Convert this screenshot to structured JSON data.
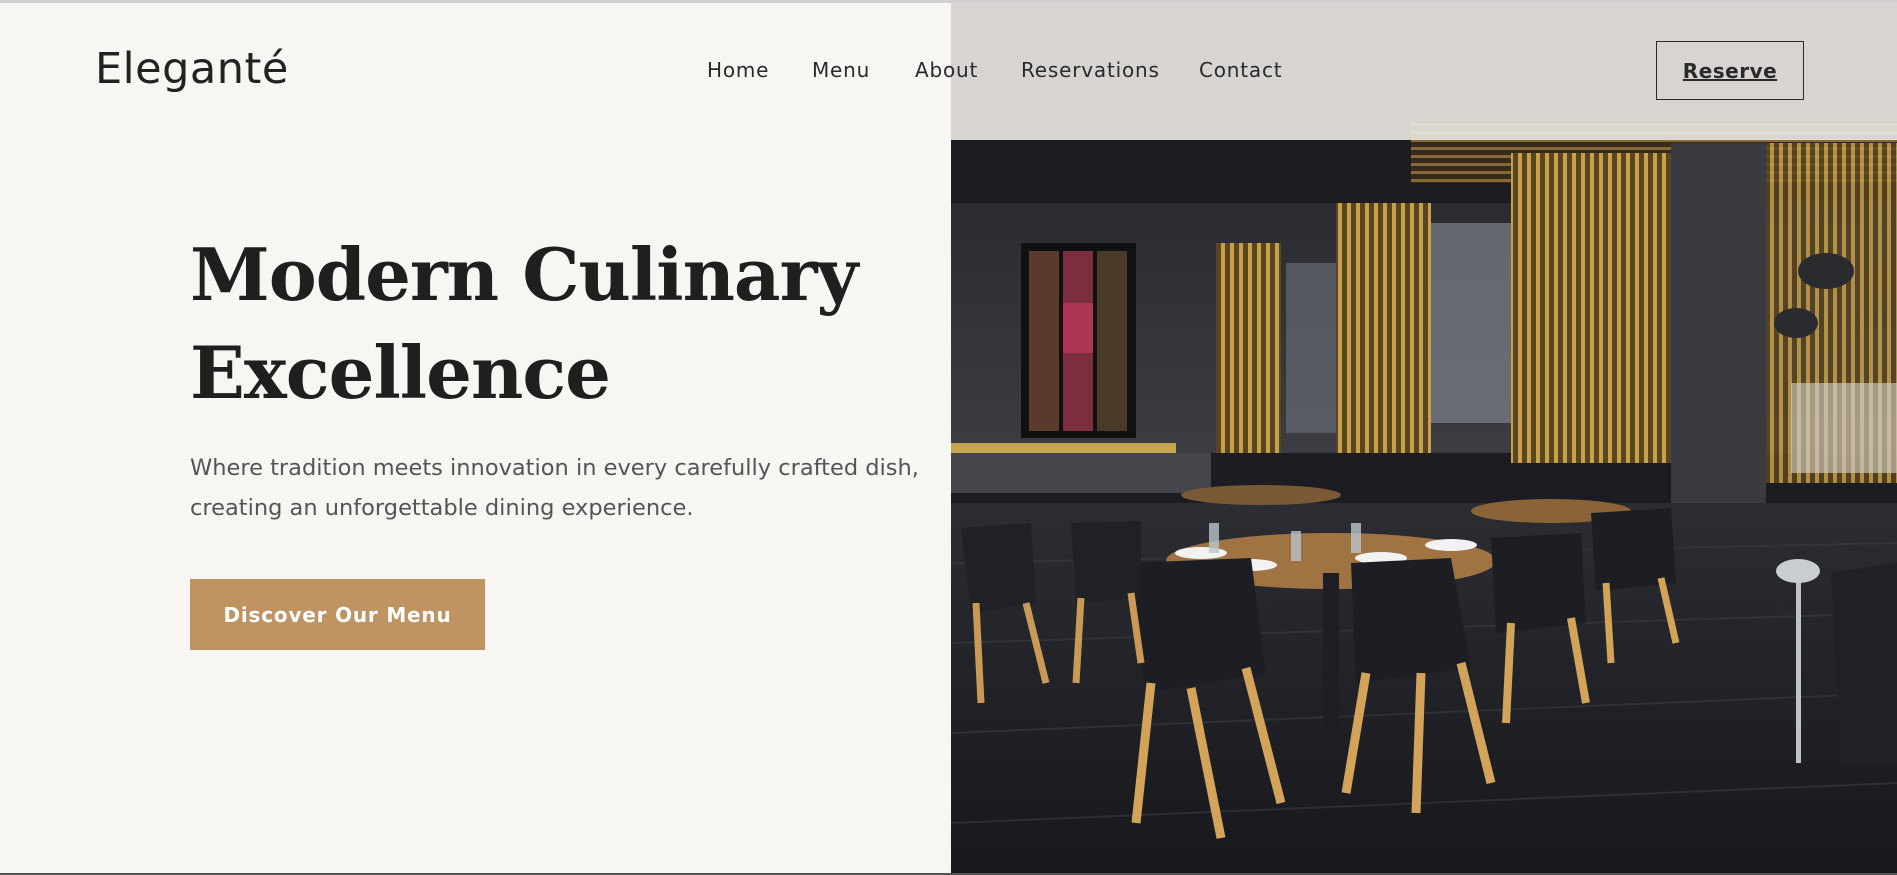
{
  "brand": {
    "name": "Eleganté"
  },
  "nav": {
    "items": [
      {
        "label": "Home"
      },
      {
        "label": "Menu"
      },
      {
        "label": "About"
      },
      {
        "label": "Reservations"
      },
      {
        "label": "Contact"
      }
    ],
    "reserve_label": "Reserve"
  },
  "hero": {
    "title_line1": "Modern Culinary",
    "title_line2": "Excellence",
    "subtitle_line1": "Where tradition meets innovation in every carefully crafted dish,",
    "subtitle_line2": "creating an unforgettable dining experience.",
    "cta_label": "Discover Our Menu",
    "image": "restaurant-interior-photo"
  },
  "colors": {
    "background": "#f8f6f2",
    "accent": "#c09462",
    "text_dark": "#1f1f1f",
    "text_muted": "#555555"
  }
}
